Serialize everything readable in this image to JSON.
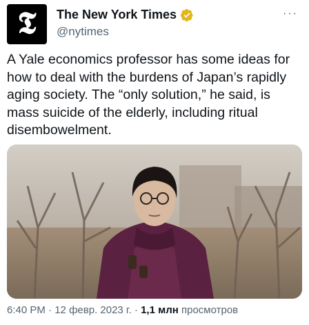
{
  "account": {
    "display_name": "The New York Times",
    "handle": "@nytimes",
    "avatar_glyph": "𝕿",
    "verified_color": "#e2b719"
  },
  "tweet": {
    "text": "A Yale economics professor has some ideas for how to deal with the burdens of Japan’s rapidly aging society. The “only solution,” he said, is mass suicide of the elderly, including ritual disembowelment.",
    "time": "6:40 PM",
    "date": "12 февр. 2023 г.",
    "separator": "·",
    "views_count": "1,1 млн",
    "views_label": "просмотров"
  },
  "more_menu": {
    "label": "···"
  },
  "colors": {
    "text_primary": "#0f1419",
    "text_secondary": "#536471",
    "background": "#ffffff"
  }
}
